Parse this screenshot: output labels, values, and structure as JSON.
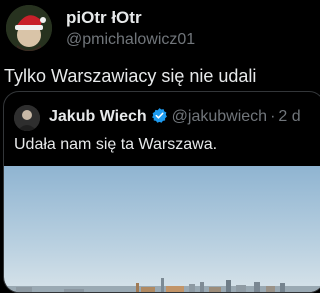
{
  "tweet": {
    "display_name": "piOtr łOtr",
    "handle": "@pmichalowicz01",
    "text": "Tylko Warszawiacy się nie udali",
    "avatar_icon": "santa-hat-avatar"
  },
  "quoted_tweet": {
    "display_name": "Jakub Wiech",
    "verified_icon": "verified-badge-icon",
    "handle": "@jakubwiech",
    "separator": "·",
    "time": "2 d",
    "text": "Udała nam się ta Warszawa.",
    "media": {
      "description_icon": "city-skyline-photo"
    }
  },
  "colors": {
    "background": "#000000",
    "primary_text": "#e7e9ea",
    "secondary_text": "#71767b",
    "border": "#333639",
    "verified_blue": "#1d9bf0",
    "sky_light": "#c9dde8",
    "sky_blue": "#8fb4d1"
  }
}
